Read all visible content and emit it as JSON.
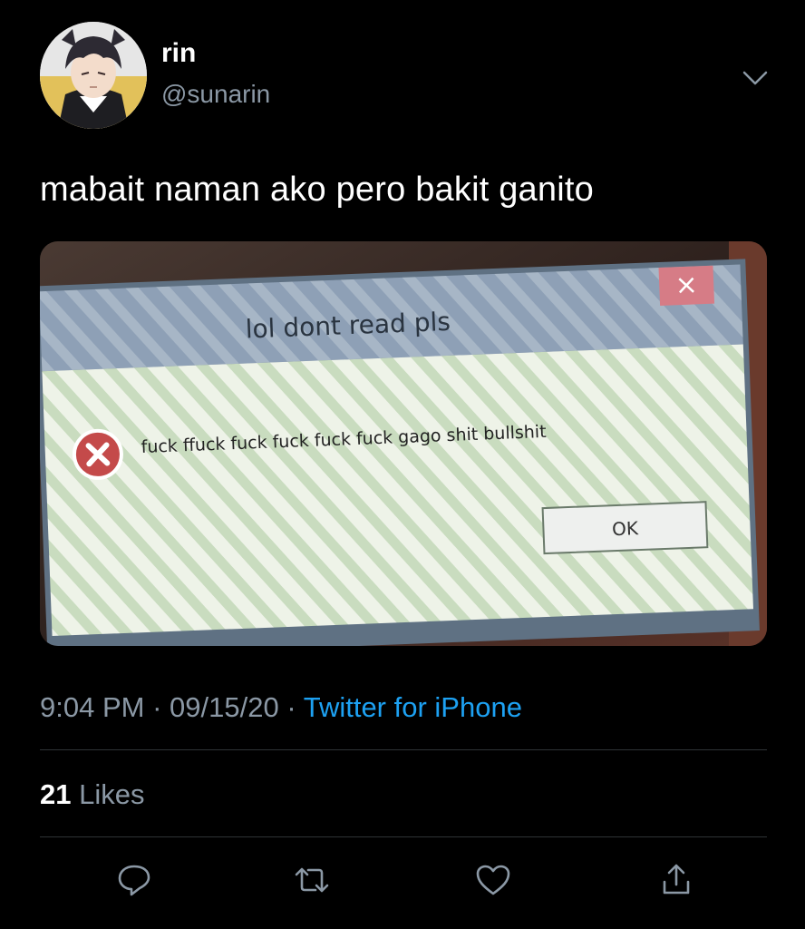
{
  "tweet": {
    "author": {
      "display_name": "rin",
      "handle": "@sunarin"
    },
    "text": "mabait naman ako pero bakit ganito",
    "media": {
      "dialog_title": "lol dont read pls",
      "dialog_message": "fuck ffuck fuck fuck fuck fuck gago shit  bullshit",
      "ok_button_label": "OK",
      "close_glyph": "×"
    },
    "time": "9:04 PM",
    "separator": "·",
    "date": "09/15/20",
    "source": "Twitter for iPhone",
    "likes_count": "21",
    "likes_label": "Likes"
  },
  "actions": [
    "reply-icon",
    "retweet-icon",
    "like-icon",
    "share-icon"
  ],
  "colors": {
    "background": "#000000",
    "secondary_text": "#8b98a5",
    "link": "#1da1f2",
    "divider": "#2f3336"
  }
}
